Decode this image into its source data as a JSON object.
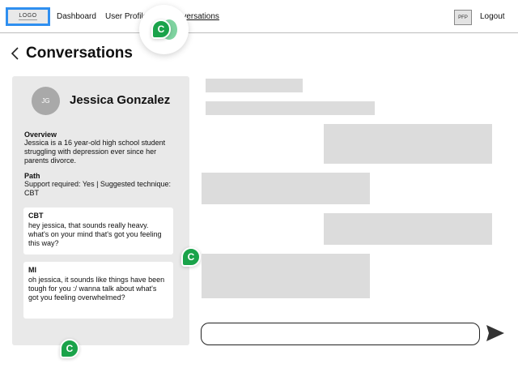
{
  "nav": {
    "logo_text": "LOGO",
    "dashboard": "Dashboard",
    "user_profile": "User Profile",
    "conversations": "Conversations",
    "pfp": "PFP",
    "logout": "Logout"
  },
  "comment_badges": {
    "top": "C",
    "middle": "C",
    "bottom": "C"
  },
  "page": {
    "title": "Conversations"
  },
  "profile": {
    "initials": "JG",
    "name": "Jessica Gonzalez",
    "overview_label": "Overview",
    "overview_text": "Jessica is a 16 year-old high school student struggling with depression ever since her parents divorce.",
    "path_label": "Path",
    "path_text": "Support required: Yes | Suggested technique: CBT"
  },
  "suggestions": [
    {
      "title": "CBT",
      "body": "hey jessica, that sounds really heavy. what's on your mind that's got you feeling this way?"
    },
    {
      "title": "MI",
      "body": "oh jessica, it sounds like things have been tough for you :/ wanna talk about what's got you feeling overwhelmed?"
    }
  ],
  "composer": {
    "value": "",
    "placeholder": ""
  },
  "icons": {
    "back": "chevron-left-icon",
    "send": "send-icon"
  },
  "colors": {
    "accent_logo_border": "#2f8ff0",
    "comment_green": "#1aa34a",
    "placeholder_gray": "#dcdcdc",
    "panel_gray": "#e9e9e9"
  }
}
